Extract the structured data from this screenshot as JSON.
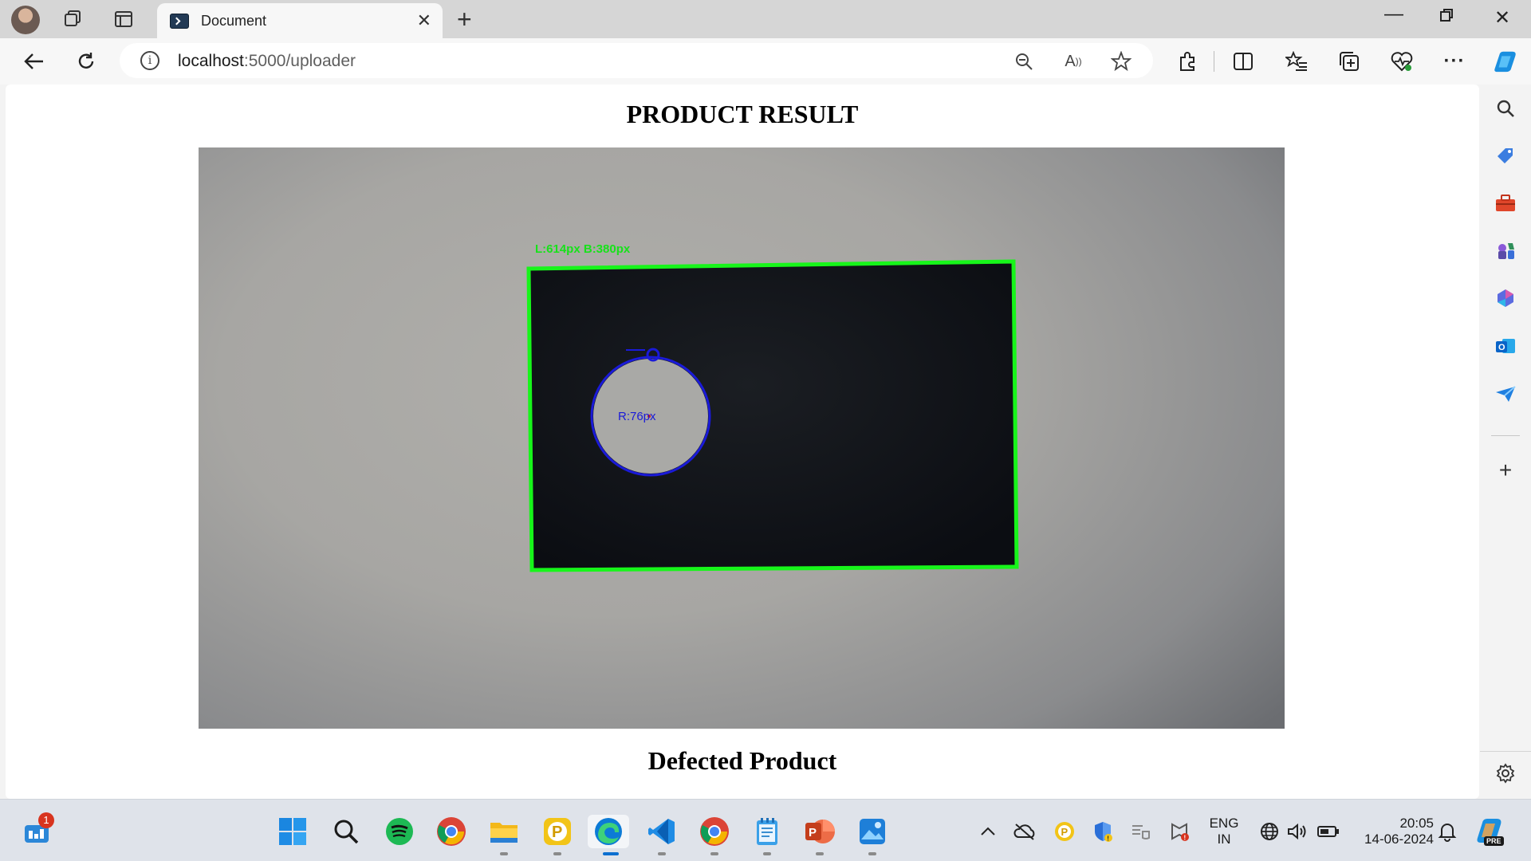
{
  "browser": {
    "tab_title": "Document",
    "url_host": "localhost",
    "url_path": ":5000/uploader"
  },
  "page": {
    "title": "PRODUCT RESULT",
    "subtitle": "Defected Product"
  },
  "annotations": {
    "box_label": "L:614px  B:380px",
    "radius_label": "R:76px"
  },
  "taskbar": {
    "widgets_badge": "1",
    "language_line1": "ENG",
    "language_line2": "IN",
    "time": "20:05",
    "date": "14-06-2024",
    "copilot_badge": "PRE"
  },
  "colors": {
    "detection_box": "#17f51a",
    "defect_circle": "#1a1ad8",
    "edge_brand": "#0c7bd6"
  }
}
